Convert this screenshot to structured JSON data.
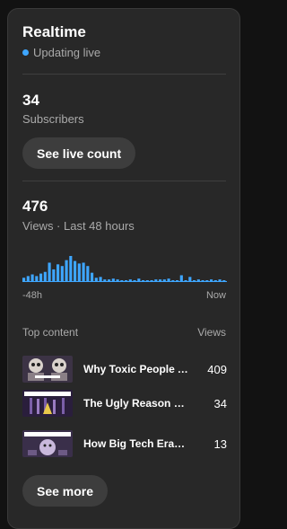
{
  "realtime": {
    "title": "Realtime",
    "status": "Updating live",
    "status_color": "#3ea6ff"
  },
  "subscribers": {
    "count": "34",
    "label": "Subscribers",
    "button_label": "See live count"
  },
  "views": {
    "count": "476",
    "label": "Views · Last 48 hours"
  },
  "chart_data": {
    "type": "bar",
    "bar_color": "#3ea6ff",
    "x_start_label": "-48h",
    "x_end_label": "Now",
    "values": [
      4,
      6,
      8,
      6,
      9,
      11,
      22,
      14,
      20,
      18,
      25,
      30,
      24,
      21,
      22,
      18,
      10,
      4,
      5,
      2,
      2,
      3,
      2,
      1,
      1,
      2,
      1,
      3,
      1,
      1,
      1,
      2,
      2,
      2,
      3,
      1,
      1,
      7,
      1,
      5,
      1,
      2,
      1,
      1,
      2,
      1,
      2,
      1
    ]
  },
  "top_content": {
    "header_left": "Top content",
    "header_right": "Views",
    "items": [
      {
        "title": "Why Toxic People Are So Dangerous",
        "views": "409",
        "thumb": "skull"
      },
      {
        "title": "The Ugly Reason Truth Is Silenced",
        "views": "34",
        "thumb": "silence"
      },
      {
        "title": "How Big Tech Erased Your Privacy",
        "views": "13",
        "thumb": "control"
      }
    ],
    "see_more_label": "See more"
  }
}
